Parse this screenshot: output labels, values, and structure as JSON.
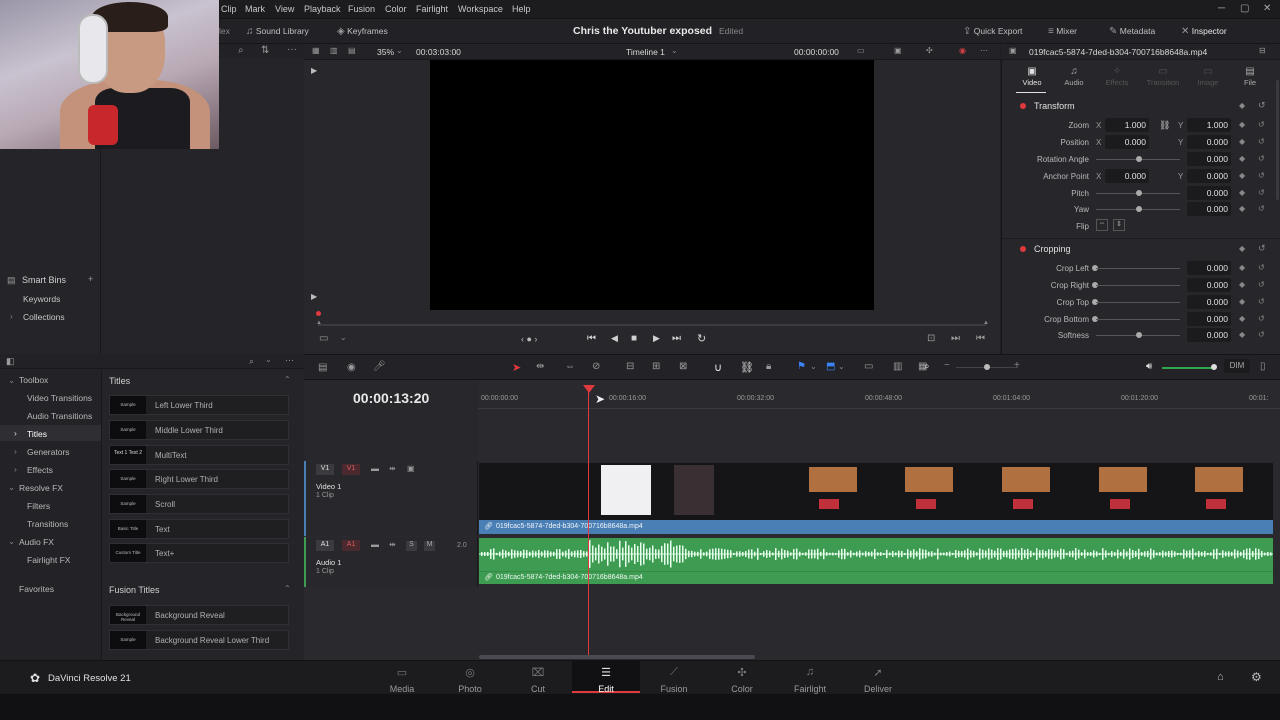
{
  "menu": {
    "items": [
      "Clip",
      "Mark",
      "View",
      "Playback",
      "Fusion",
      "Color",
      "Fairlight",
      "Workspace",
      "Help"
    ],
    "left_fragment": "lex"
  },
  "toolbar": {
    "sound_library": "Sound Library",
    "keyframes": "Keyframes",
    "project_title": "Chris the Youtuber exposed",
    "edited_status": "Edited",
    "quick_export": "Quick Export",
    "mixer": "Mixer",
    "metadata": "Metadata",
    "inspector": "Inspector"
  },
  "viewer": {
    "zoom": "35%",
    "source_timecode": "00:03:03:00",
    "timeline_name": "Timeline 1",
    "record_timecode": "00:00:00:00",
    "clip_name": "019fcac5-5874-7ded-b304-700716b8648a.mp4"
  },
  "media_pool": {
    "smart_bins": "Smart Bins",
    "keywords": "Keywords",
    "collections": "Collections"
  },
  "inspector": {
    "tabs": [
      "Video",
      "Audio",
      "Effects",
      "Transition",
      "Image",
      "File"
    ],
    "transform": {
      "title": "Transform",
      "zoom": {
        "label": "Zoom",
        "x": "1.000",
        "y": "1.000"
      },
      "position": {
        "label": "Position",
        "x": "0.000",
        "y": "0.000"
      },
      "rotation": {
        "label": "Rotation Angle",
        "value": "0.000"
      },
      "anchor": {
        "label": "Anchor Point",
        "x": "0.000",
        "y": "0.000"
      },
      "pitch": {
        "label": "Pitch",
        "value": "0.000"
      },
      "yaw": {
        "label": "Yaw",
        "value": "0.000"
      },
      "flip": {
        "label": "Flip"
      }
    },
    "cropping": {
      "title": "Cropping",
      "crop_left": {
        "label": "Crop Left",
        "value": "0.000"
      },
      "crop_right": {
        "label": "Crop Right",
        "value": "0.000"
      },
      "crop_top": {
        "label": "Crop Top",
        "value": "0.000"
      },
      "crop_bottom": {
        "label": "Crop Bottom",
        "value": "0.000"
      },
      "softness": {
        "label": "Softness",
        "value": "0.000"
      }
    },
    "axis_x": "X",
    "axis_y": "Y"
  },
  "effects_library": {
    "sidebar": [
      "Toolbox",
      "Video Transitions",
      "Audio Transitions",
      "Titles",
      "Generators",
      "Effects",
      "Resolve FX",
      "Filters",
      "Transitions",
      "Audio FX",
      "Fairlight FX",
      "Favorites"
    ],
    "titles_header": "Titles",
    "titles": [
      {
        "name": "Left Lower Third",
        "thumb": "Sample"
      },
      {
        "name": "Middle Lower Third",
        "thumb": "Sample"
      },
      {
        "name": "MultiText",
        "thumb": "Text 1 Text 2"
      },
      {
        "name": "Right Lower Third",
        "thumb": "Sample"
      },
      {
        "name": "Scroll",
        "thumb": "Sample"
      },
      {
        "name": "Text",
        "thumb": "Basic Title"
      },
      {
        "name": "Text+",
        "thumb": "Custom Title"
      }
    ],
    "fusion_header": "Fusion Titles",
    "fusion_titles": [
      {
        "name": "Background Reveal",
        "thumb": "Background Reveal"
      },
      {
        "name": "Background Reveal Lower Third",
        "thumb": "Sample"
      }
    ]
  },
  "timeline": {
    "timecode": "00:00:13:20",
    "ruler": [
      "00:00:00:00",
      "00:00:16:00",
      "00:00:32:00",
      "00:00:48:00",
      "00:01:04:00",
      "00:01:20:00",
      "00:01:"
    ],
    "video_track": {
      "badge_left": "V1",
      "badge_right": "V1",
      "name": "Video 1",
      "clips": "1 Clip"
    },
    "audio_track": {
      "badge_left": "A1",
      "badge_right": "A1",
      "name": "Audio 1",
      "clips": "1 Clip",
      "solo": "S",
      "mute": "M",
      "channels": "2.0"
    },
    "clip_name": "019fcac5-5874-7ded-b304-700716b8648a.mp4",
    "dim_label": "DIM"
  },
  "bottom_nav": {
    "app_name": "DaVinci Resolve 21",
    "pages": [
      "Media",
      "Photo",
      "Cut",
      "Edit",
      "Fusion",
      "Color",
      "Fairlight",
      "Deliver"
    ],
    "active": "Edit"
  },
  "colors": {
    "accent_red": "#e0393e",
    "video_clip_blue": "#4a7fb5",
    "audio_clip_green": "#3e9c52"
  }
}
